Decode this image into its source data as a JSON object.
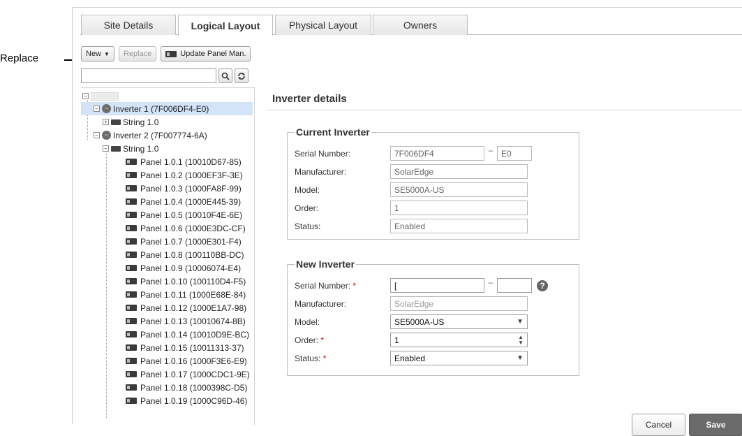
{
  "callout": {
    "label": "Replace"
  },
  "tabs": [
    {
      "label": "Site Details",
      "active": false
    },
    {
      "label": "Logical Layout",
      "active": true
    },
    {
      "label": "Physical Layout",
      "active": false
    },
    {
      "label": "Owners",
      "active": false
    }
  ],
  "toolbar": {
    "new_label": "New",
    "replace_label": "Replace",
    "update_label": "Update Panel Man."
  },
  "search": {
    "value": "",
    "placeholder": ""
  },
  "tree": {
    "inverter1": "Inverter 1 (7F006DF4-E0)",
    "inverter1_string": "String 1.0",
    "inverter2": "Inverter 2 (7F007774-6A)",
    "inverter2_string": "String 1.0",
    "panels": [
      "Panel 1.0.1 (10010D67-85)",
      "Panel 1.0.2 (1000EF3F-3E)",
      "Panel 1.0.3 (1000FA8F-99)",
      "Panel 1.0.4 (1000E445-39)",
      "Panel 1.0.5 (10010F4E-6E)",
      "Panel 1.0.6 (1000E3DC-CF)",
      "Panel 1.0.7 (1000E301-F4)",
      "Panel 1.0.8 (100110BB-DC)",
      "Panel 1.0.9 (10006074-E4)",
      "Panel 1.0.10 (100110D4-F5)",
      "Panel 1.0.11 (1000E68E-84)",
      "Panel 1.0.12 (1000E1A7-98)",
      "Panel 1.0.13 (10010674-8B)",
      "Panel 1.0.14 (10010D9E-BC)",
      "Panel 1.0.15 (10011313-37)",
      "Panel 1.0.16 (1000F3E6-E9)",
      "Panel 1.0.17 (1000CDC1-9E)",
      "Panel 1.0.18 (1000398C-D5)",
      "Panel 1.0.19 (1000C96D-46)"
    ]
  },
  "details": {
    "title": "Inverter details",
    "current": {
      "legend": "Current Inverter",
      "serial_label": "Serial Number:",
      "serial_value": "7F006DF4",
      "serial_suffix": "E0",
      "manufacturer_label": "Manufacturer:",
      "manufacturer_value": "SolarEdge",
      "model_label": "Model:",
      "model_value": "SE5000A-US",
      "order_label": "Order:",
      "order_value": "1",
      "status_label": "Status:",
      "status_value": "Enabled"
    },
    "new": {
      "legend": "New Inverter",
      "serial_label": "Serial Number:",
      "serial_value": "[",
      "serial_suffix": "",
      "manufacturer_label": "Manufacturer:",
      "manufacturer_value": "SolarEdge",
      "model_label": "Model:",
      "model_value": "SE5000A-US",
      "order_label": "Order:",
      "order_value": "1",
      "status_label": "Status:",
      "status_value": "Enabled",
      "required_mark": "*"
    }
  },
  "actions": {
    "cancel_label": "Cancel",
    "save_label": "Save"
  },
  "colors": {
    "selected_row": "#d3e3f8",
    "save_bg": "#6b6b6b",
    "required": "#dd0000"
  },
  "icons": [
    "arrow-right-icon",
    "dropdown-caret-icon",
    "panel-icon",
    "search-icon",
    "refresh-icon",
    "inverter-icon",
    "string-icon",
    "help-icon"
  ]
}
